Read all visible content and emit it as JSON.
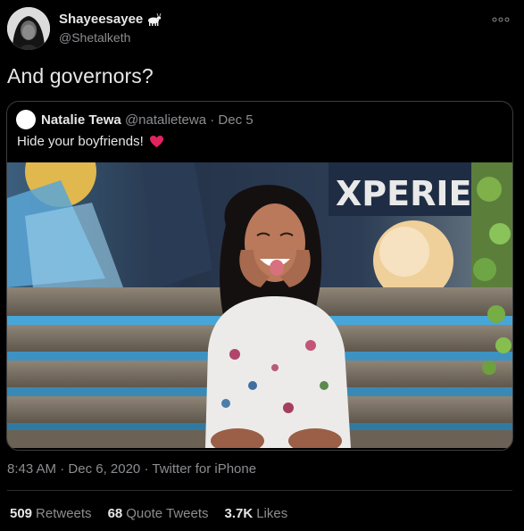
{
  "author": {
    "display_name": "Shayeesayee",
    "name_emoji_icon": "goat-icon",
    "handle": "@Shetalketh"
  },
  "tweet": {
    "text": "And governors?"
  },
  "quoted_tweet": {
    "display_name": "Natalie Tewa",
    "handle": "@natalietewa",
    "separator": "·",
    "date": "Dec 5",
    "text": "Hide your boyfriends!",
    "emoji_icon": "heart-icon",
    "heart_color": "#e0245e",
    "photo_icon": "photo-of-woman-on-bench"
  },
  "meta": {
    "time": "8:43 AM",
    "sep1": "·",
    "date": "Dec 6, 2020",
    "sep2": "·",
    "source": "Twitter for iPhone"
  },
  "stats": {
    "retweets_count": "509",
    "retweets_label": "Retweets",
    "quotes_count": "68",
    "quotes_label": "Quote Tweets",
    "likes_count": "3.7K",
    "likes_label": "Likes"
  },
  "colors": {
    "background": "#000000",
    "text_primary": "#e7e7e7",
    "text_secondary": "#8b8d90",
    "border": "#3b3d40"
  }
}
